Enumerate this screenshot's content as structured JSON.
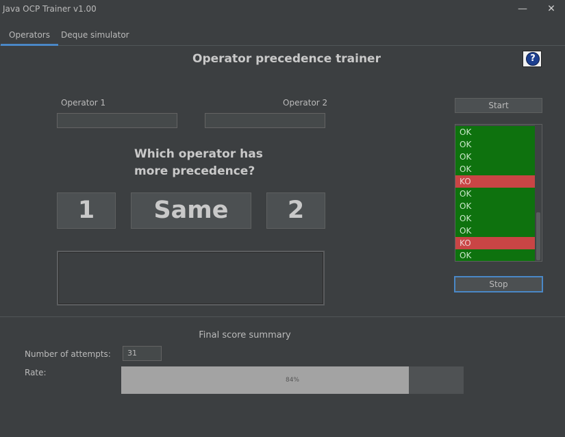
{
  "window": {
    "title": "Java OCP Trainer v1.00",
    "minimize_glyph": "—",
    "close_glyph": "✕"
  },
  "tabs": [
    {
      "label": "Operators",
      "active": true
    },
    {
      "label": "Deque simulator",
      "active": false
    }
  ],
  "page": {
    "title": "Operator precedence trainer",
    "help_glyph": "?"
  },
  "operators": {
    "operator1_label": "Operator 1",
    "operator1_value": "",
    "operator2_label": "Operator 2",
    "operator2_value": ""
  },
  "question": {
    "line1": "Which operator has",
    "line2": "more precedence?"
  },
  "answers": {
    "one": "1",
    "same": "Same",
    "two": "2"
  },
  "controls": {
    "start_label": "Start",
    "stop_label": "Stop"
  },
  "results": [
    "OK",
    "OK",
    "OK",
    "OK",
    "KO",
    "OK",
    "OK",
    "OK",
    "OK",
    "KO",
    "OK"
  ],
  "summary": {
    "title": "Final score summary",
    "attempts_label": "Number of attempts:",
    "attempts_value": "31",
    "rate_label": "Rate:",
    "rate_percent": 84,
    "rate_text": "84%"
  },
  "colors": {
    "ok": "#0e720e",
    "ko": "#c94545",
    "accent": "#4a88c7",
    "background": "#3c3f41"
  }
}
